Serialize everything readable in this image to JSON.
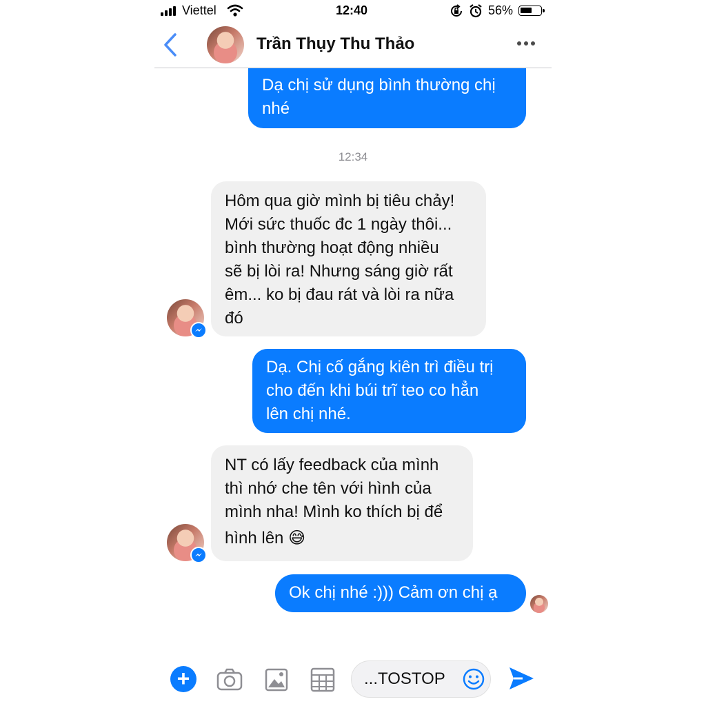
{
  "status_bar": {
    "carrier": "Viettel",
    "time": "12:40",
    "battery_percent": "56%",
    "battery_level": 0.56,
    "icons": [
      "signal-icon",
      "wifi-icon",
      "rotation-lock-icon",
      "alarm-icon",
      "battery-icon"
    ]
  },
  "header": {
    "contact_name": "Trần Thụy Thu Thảo",
    "back_icon": "chevron-left-icon",
    "more_icon": "more-dots-icon"
  },
  "messages": [
    {
      "sender": "me",
      "lines": [
        "Dạ chị sử dụng bình thường chị",
        "nhé"
      ]
    },
    {
      "type": "timestamp",
      "text": "12:34"
    },
    {
      "sender": "contact",
      "lines": [
        "Hôm qua giờ mình bị tiêu chảy!",
        "Mới sức thuốc đc 1 ngày thôi...",
        "bình thường hoạt động nhiều",
        "sẽ bị lòi ra! Nhưng sáng giờ rất",
        "êm... ko bị đau rát và lòi ra nữa",
        "đó"
      ]
    },
    {
      "sender": "me",
      "lines": [
        "Dạ. Chị cố gắng kiên trì điều trị",
        "cho đến khi búi trĩ teo co hẳn",
        "lên chị nhé."
      ]
    },
    {
      "sender": "contact",
      "lines": [
        "NT có lấy feedback của mình",
        "thì nhớ che tên với hình của",
        "mình nha! Mình ko thích bị để",
        "hình lên"
      ],
      "emoji": "😅"
    },
    {
      "sender": "me",
      "lines": [
        "Ok chị nhé :))) Cảm ơn chị ạ"
      ]
    }
  ],
  "composer": {
    "input_value": "...TOSTOP",
    "buttons": [
      "plus-icon",
      "camera-icon",
      "photo-icon",
      "grid-icon",
      "emoji-icon",
      "send-icon"
    ]
  },
  "colors": {
    "accent": "#0a7cff",
    "incoming_bubble": "#f0f0f0",
    "timestamp": "#8e8e93"
  }
}
